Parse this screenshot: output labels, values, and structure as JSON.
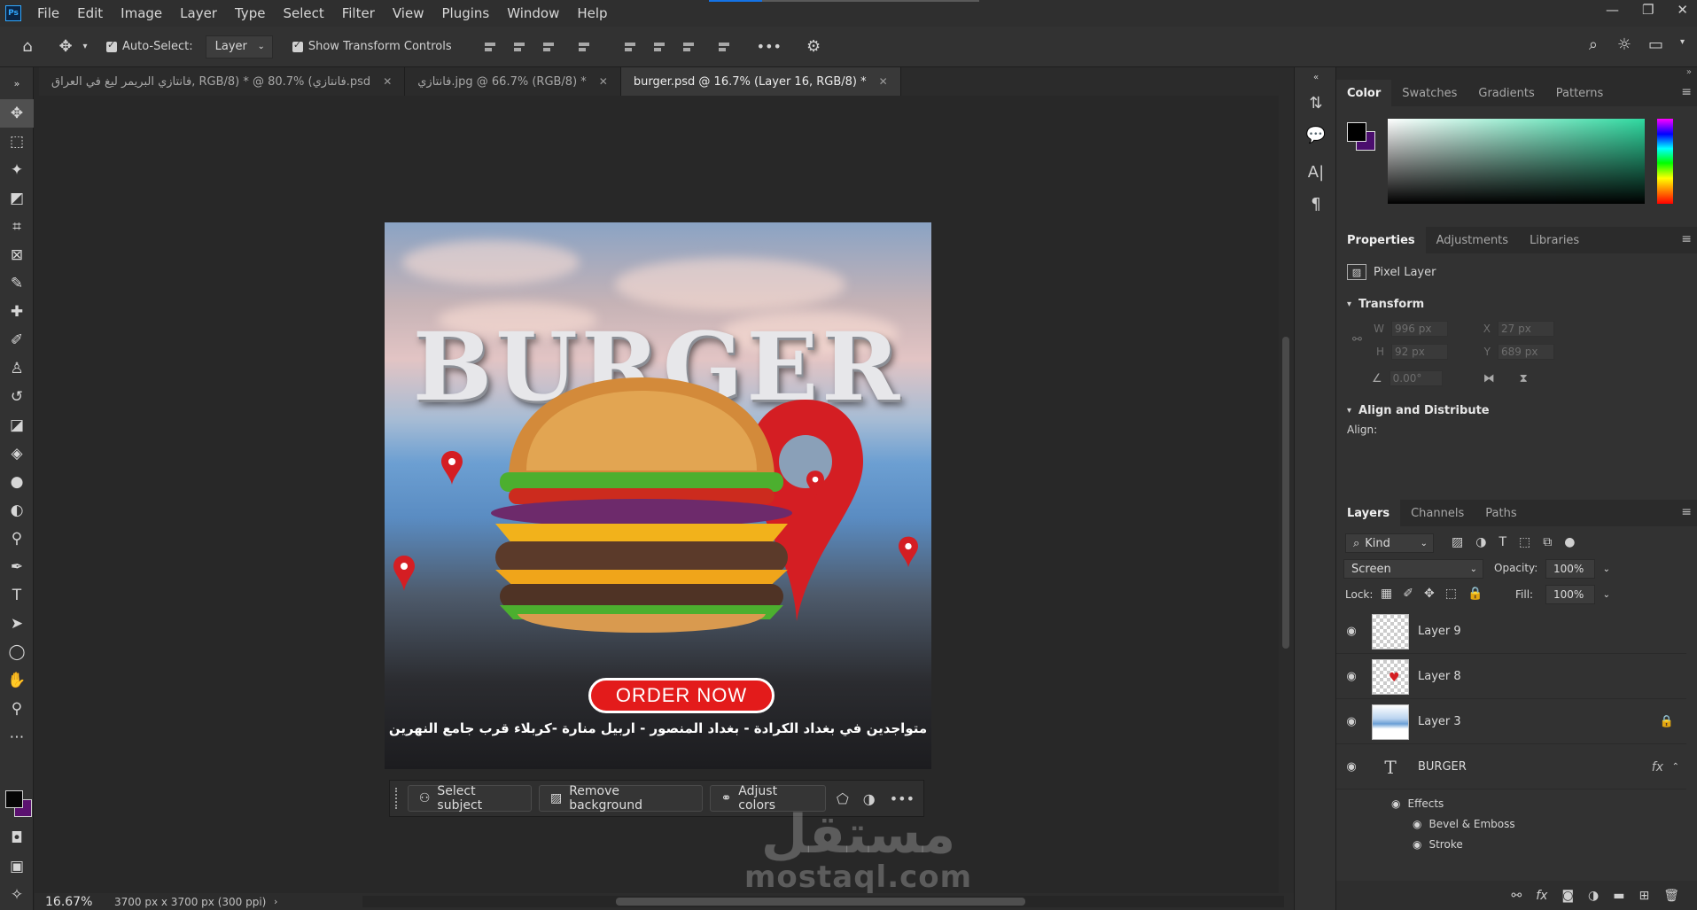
{
  "menubar": {
    "logo": "Ps",
    "items": [
      "File",
      "Edit",
      "Image",
      "Layer",
      "Type",
      "Select",
      "Filter",
      "View",
      "Plugins",
      "Window",
      "Help"
    ],
    "window_controls": [
      "—",
      "❐",
      "✕"
    ]
  },
  "options": {
    "auto_select_label": "Auto-Select:",
    "auto_select_target": "Layer",
    "show_transform_label": "Show Transform Controls",
    "more": "•••"
  },
  "tabs": [
    {
      "label": "فانتازي البريمر ليغ في العراق, RGB/8) * @ 80.7% (فانتازي.psd",
      "close": "✕"
    },
    {
      "label": "فانتازي.jpg @ 66.7% (RGB/8) *",
      "close": "✕"
    },
    {
      "label": "burger.psd @ 16.7% (Layer 16, RGB/8) *",
      "close": "✕"
    }
  ],
  "artwork": {
    "title": "BURGER",
    "button": "ORDER NOW",
    "arabic_line": "متواجدين في بغداد الكرادة - بغداد المنصور - اربيل منارة -كربلاء قرب جامع النهرين",
    "colors": {
      "accent_red": "#e31b1b"
    }
  },
  "taskbar": {
    "select_subject": "Select subject",
    "remove_background": "Remove background",
    "adjust_colors": "Adjust colors",
    "more": "•••"
  },
  "watermark": {
    "arabic": "مستقل",
    "latin": "mostaql.com"
  },
  "status": {
    "zoom": "16.67%",
    "doc_size": "3700 px x 3700 px (300 ppi)"
  },
  "color_panel": {
    "tabs": [
      "Color",
      "Swatches",
      "Gradients",
      "Patterns"
    ],
    "fg": "#000000",
    "bg": "#4b0e6e"
  },
  "properties": {
    "tabs": [
      "Properties",
      "Adjustments",
      "Libraries"
    ],
    "layer_type": "Pixel Layer",
    "transform_title": "Transform",
    "w_label": "W",
    "w_value": "996 px",
    "h_label": "H",
    "h_value": "92 px",
    "x_label": "X",
    "x_value": "27 px",
    "y_label": "Y",
    "y_value": "689 px",
    "angle_value": "0.00°",
    "align_title": "Align and Distribute",
    "align_label": "Align:"
  },
  "layers": {
    "tabs": [
      "Layers",
      "Channels",
      "Paths"
    ],
    "kind": "Kind",
    "blend_mode": "Screen",
    "opacity_label": "Opacity:",
    "opacity_value": "100%",
    "lock_label": "Lock:",
    "fill_label": "Fill:",
    "fill_value": "100%",
    "items": [
      {
        "name": "Layer 9"
      },
      {
        "name": "Layer 8"
      },
      {
        "name": "Layer 3"
      },
      {
        "name": "BURGER"
      }
    ],
    "effects_label": "Effects",
    "effects": [
      "Bevel & Emboss",
      "Stroke"
    ],
    "fx": "fx"
  }
}
